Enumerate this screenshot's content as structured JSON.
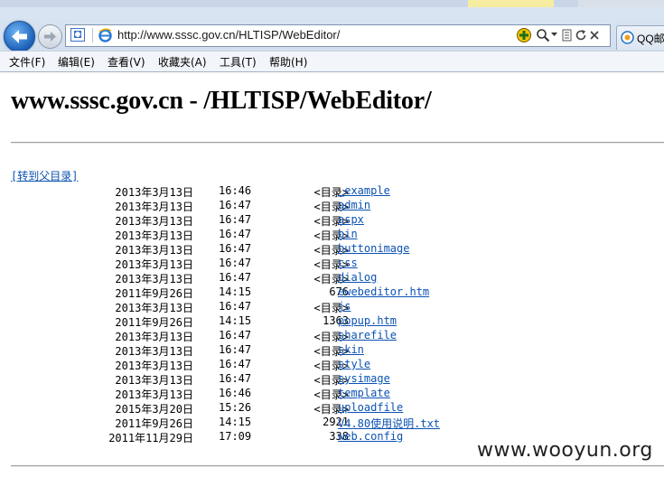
{
  "browser": {
    "address_url": "http://www.sssc.gov.cn/HLTISP/WebEditor/",
    "tab_label": "QQ邮",
    "menu": [
      "文件(F)",
      "编辑(E)",
      "查看(V)",
      "收藏夹(A)",
      "工具(T)",
      "帮助(H)"
    ]
  },
  "page": {
    "heading": "www.sssc.gov.cn - /HLTISP/WebEditor/",
    "parent_link": "[转到父目录]",
    "entries": [
      {
        "date": "2013年3月13日",
        "time": "16:46",
        "size": "<目录>",
        "name": "_example"
      },
      {
        "date": "2013年3月13日",
        "time": "16:47",
        "size": "<目录>",
        "name": "admin"
      },
      {
        "date": "2013年3月13日",
        "time": "16:47",
        "size": "<目录>",
        "name": "aspx"
      },
      {
        "date": "2013年3月13日",
        "time": "16:47",
        "size": "<目录>",
        "name": "bin"
      },
      {
        "date": "2013年3月13日",
        "time": "16:47",
        "size": "<目录>",
        "name": "buttonimage"
      },
      {
        "date": "2013年3月13日",
        "time": "16:47",
        "size": "<目录>",
        "name": "css"
      },
      {
        "date": "2013年3月13日",
        "time": "16:47",
        "size": "<目录>",
        "name": "dialog"
      },
      {
        "date": "2011年9月26日",
        "time": "14:15",
        "size": "676",
        "name": "ewebeditor.htm"
      },
      {
        "date": "2013年3月13日",
        "time": "16:47",
        "size": "<目录>",
        "name": "js"
      },
      {
        "date": "2011年9月26日",
        "time": "14:15",
        "size": "1363",
        "name": "popup.htm"
      },
      {
        "date": "2013年3月13日",
        "time": "16:47",
        "size": "<目录>",
        "name": "sharefile"
      },
      {
        "date": "2013年3月13日",
        "time": "16:47",
        "size": "<目录>",
        "name": "skin"
      },
      {
        "date": "2013年3月13日",
        "time": "16:47",
        "size": "<目录>",
        "name": "style"
      },
      {
        "date": "2013年3月13日",
        "time": "16:47",
        "size": "<目录>",
        "name": "sysimage"
      },
      {
        "date": "2013年3月13日",
        "time": "16:46",
        "size": "<目录>",
        "name": "template"
      },
      {
        "date": "2015年3月20日",
        "time": "15:26",
        "size": "<目录>",
        "name": "uploadfile"
      },
      {
        "date": "2011年9月26日",
        "time": "14:15",
        "size": "2921",
        "name": "V4.80使用说明.txt"
      },
      {
        "date": "2011年11月29日",
        "time": "17:09",
        "size": "338",
        "name": "web.config"
      }
    ]
  },
  "watermark": "www.wooyun.org",
  "colors": {
    "link": "#0b52b3",
    "chrome_bg": "#dbe6f3",
    "back_button": "#1b5fb8"
  }
}
